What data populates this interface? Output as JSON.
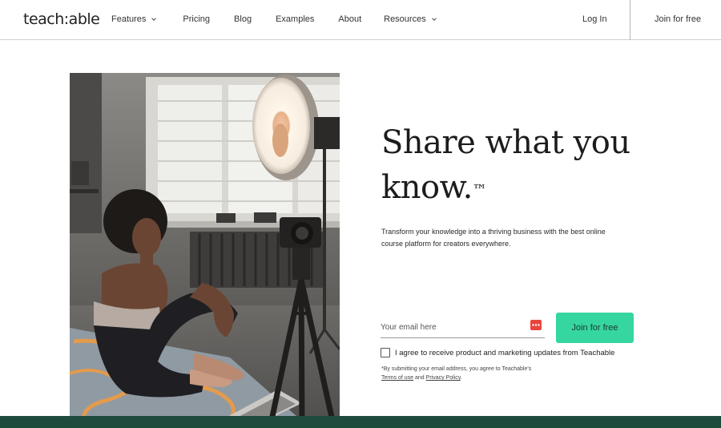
{
  "header": {
    "logo": "teach:able",
    "nav": {
      "features": "Features",
      "pricing": "Pricing",
      "blog": "Blog",
      "examples": "Examples",
      "about": "About",
      "resources": "Resources"
    },
    "login": "Log In",
    "join": "Join for free"
  },
  "hero": {
    "headline_line1": "Share what you",
    "headline_line2": "know.",
    "trademark": "™",
    "subtext": "Transform your knowledge into a thriving business with the best online course platform for creators everywhere."
  },
  "form": {
    "email_placeholder": "Your email here",
    "join_button": "Join for free",
    "consent_label": "I agree to receive product and marketing updates from Teachable",
    "fineprint_prefix": "*By submitting your email address, you agree to Teachable's ",
    "terms_link": "Terms of use",
    "fineprint_and": " and ",
    "privacy_link": "Privacy Policy",
    "fineprint_suffix": "."
  },
  "icons": {
    "nav_dropdown": "chevron-down-icon",
    "autofill": "autofill-icon"
  },
  "colors": {
    "accent": "#36d6a0",
    "band": "#1f4a3e"
  }
}
